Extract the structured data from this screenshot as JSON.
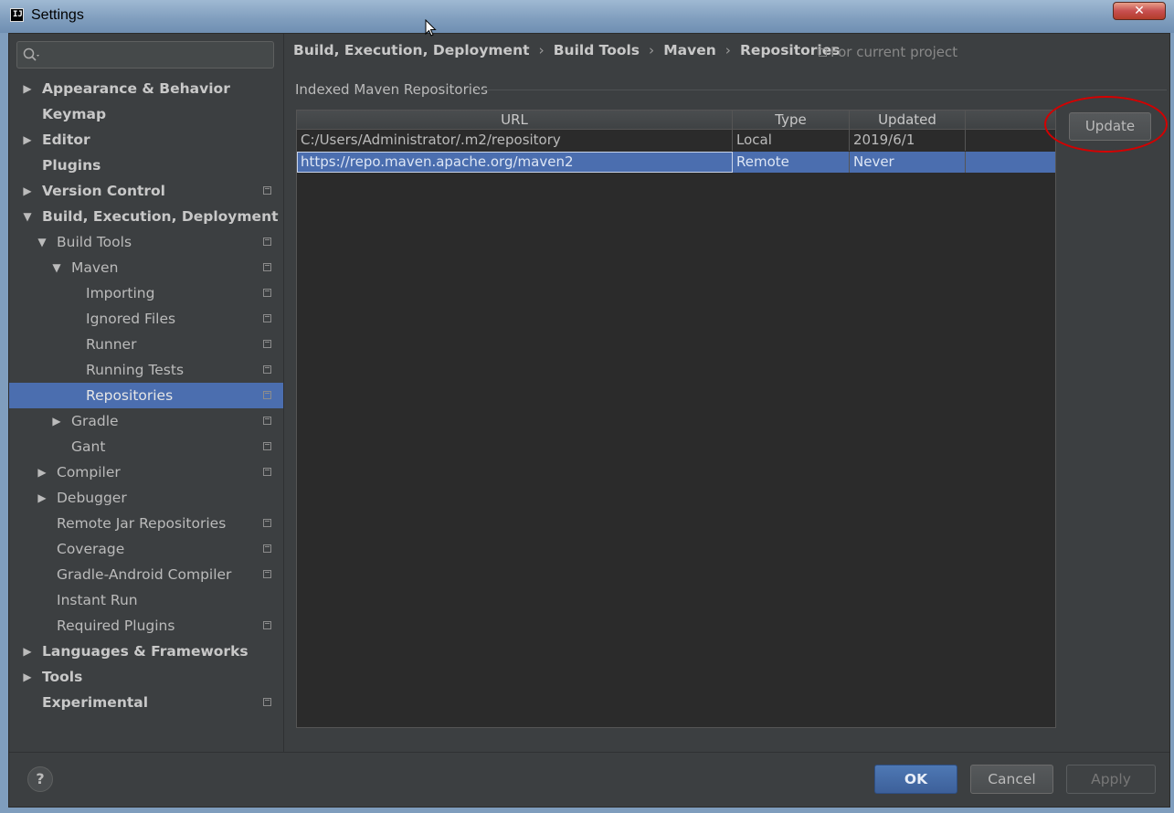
{
  "window": {
    "title": "Settings",
    "close_glyph": "✕",
    "app_icon_text": "IJ"
  },
  "search": {
    "placeholder": ""
  },
  "sidebar": {
    "items": [
      {
        "label": "Appearance & Behavior",
        "level": 0,
        "arrow": "right",
        "bold": true,
        "project": false,
        "selected": false
      },
      {
        "label": "Keymap",
        "level": 0,
        "arrow": "none",
        "bold": true,
        "project": false,
        "selected": false
      },
      {
        "label": "Editor",
        "level": 0,
        "arrow": "right",
        "bold": true,
        "project": false,
        "selected": false
      },
      {
        "label": "Plugins",
        "level": 0,
        "arrow": "none",
        "bold": true,
        "project": false,
        "selected": false
      },
      {
        "label": "Version Control",
        "level": 0,
        "arrow": "right",
        "bold": true,
        "project": true,
        "selected": false
      },
      {
        "label": "Build, Execution, Deployment",
        "level": 0,
        "arrow": "down",
        "bold": true,
        "project": false,
        "selected": false
      },
      {
        "label": "Build Tools",
        "level": 1,
        "arrow": "down",
        "bold": false,
        "project": true,
        "selected": false
      },
      {
        "label": "Maven",
        "level": 2,
        "arrow": "down",
        "bold": false,
        "project": true,
        "selected": false
      },
      {
        "label": "Importing",
        "level": 3,
        "arrow": "none",
        "bold": false,
        "project": true,
        "selected": false
      },
      {
        "label": "Ignored Files",
        "level": 3,
        "arrow": "none",
        "bold": false,
        "project": true,
        "selected": false
      },
      {
        "label": "Runner",
        "level": 3,
        "arrow": "none",
        "bold": false,
        "project": true,
        "selected": false
      },
      {
        "label": "Running Tests",
        "level": 3,
        "arrow": "none",
        "bold": false,
        "project": true,
        "selected": false
      },
      {
        "label": "Repositories",
        "level": 3,
        "arrow": "none",
        "bold": false,
        "project": true,
        "selected": true
      },
      {
        "label": "Gradle",
        "level": 2,
        "arrow": "right",
        "bold": false,
        "project": true,
        "selected": false
      },
      {
        "label": "Gant",
        "level": 2,
        "arrow": "none",
        "bold": false,
        "project": true,
        "selected": false
      },
      {
        "label": "Compiler",
        "level": 1,
        "arrow": "right",
        "bold": false,
        "project": true,
        "selected": false
      },
      {
        "label": "Debugger",
        "level": 1,
        "arrow": "right",
        "bold": false,
        "project": false,
        "selected": false
      },
      {
        "label": "Remote Jar Repositories",
        "level": 1,
        "arrow": "none",
        "bold": false,
        "project": true,
        "selected": false
      },
      {
        "label": "Coverage",
        "level": 1,
        "arrow": "none",
        "bold": false,
        "project": true,
        "selected": false
      },
      {
        "label": "Gradle-Android Compiler",
        "level": 1,
        "arrow": "none",
        "bold": false,
        "project": true,
        "selected": false
      },
      {
        "label": "Instant Run",
        "level": 1,
        "arrow": "none",
        "bold": false,
        "project": false,
        "selected": false
      },
      {
        "label": "Required Plugins",
        "level": 1,
        "arrow": "none",
        "bold": false,
        "project": true,
        "selected": false
      },
      {
        "label": "Languages & Frameworks",
        "level": 0,
        "arrow": "right",
        "bold": true,
        "project": false,
        "selected": false
      },
      {
        "label": "Tools",
        "level": 0,
        "arrow": "right",
        "bold": true,
        "project": false,
        "selected": false
      },
      {
        "label": "Experimental",
        "level": 0,
        "arrow": "none",
        "bold": true,
        "project": true,
        "selected": false
      }
    ]
  },
  "breadcrumb": [
    "Build, Execution, Deployment",
    "Build Tools",
    "Maven",
    "Repositories"
  ],
  "breadcrumb_separator": "›",
  "for_current_project": "For current project",
  "section_title": "Indexed Maven Repositories",
  "table": {
    "columns": [
      "URL",
      "Type",
      "Updated",
      ""
    ],
    "rows": [
      {
        "url": "C:/Users/Administrator/.m2/repository",
        "type": "Local",
        "updated": "2019/6/1",
        "selected": false
      },
      {
        "url": "https://repo.maven.apache.org/maven2",
        "type": "Remote",
        "updated": "Never",
        "selected": true
      }
    ]
  },
  "update_button": "Update",
  "footer": {
    "help": "?",
    "ok": "OK",
    "cancel": "Cancel",
    "apply": "Apply"
  },
  "colors": {
    "selection": "#4b6eaf",
    "background": "#3c3f41",
    "table_bg": "#2b2b2b",
    "annotation": "#d40000"
  }
}
